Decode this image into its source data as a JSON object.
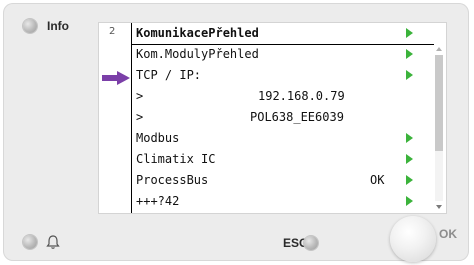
{
  "device": {
    "info_label": "Info",
    "esc_label": "ESC",
    "ok_label": "OK"
  },
  "screen": {
    "page_number": "2",
    "header": "KomunikacePřehled",
    "rows": [
      {
        "label": "Kom.ModulyPřehled",
        "value": "",
        "status": "",
        "arrow": true
      },
      {
        "label": "TCP / IP:",
        "value": "",
        "status": "",
        "arrow": true
      },
      {
        "label": ">",
        "value": "192.168.0.79",
        "status": "",
        "arrow": false
      },
      {
        "label": ">",
        "value": "POL638_EE6039",
        "status": "",
        "arrow": false
      },
      {
        "label": "Modbus",
        "value": "",
        "status": "",
        "arrow": true
      },
      {
        "label": "Climatix IC",
        "value": "",
        "status": "",
        "arrow": true
      },
      {
        "label": "ProcessBus",
        "value": "",
        "status": "OK",
        "arrow": true
      },
      {
        "label": "+++?42",
        "value": "",
        "status": "",
        "arrow": true
      }
    ],
    "scroll_position": 0.0
  },
  "colors": {
    "arrow": "#3bb33b",
    "pointer": "#7b3fa8"
  },
  "icons": {
    "pointer": "right-arrow-pointer-icon",
    "bell": "bell-icon"
  }
}
